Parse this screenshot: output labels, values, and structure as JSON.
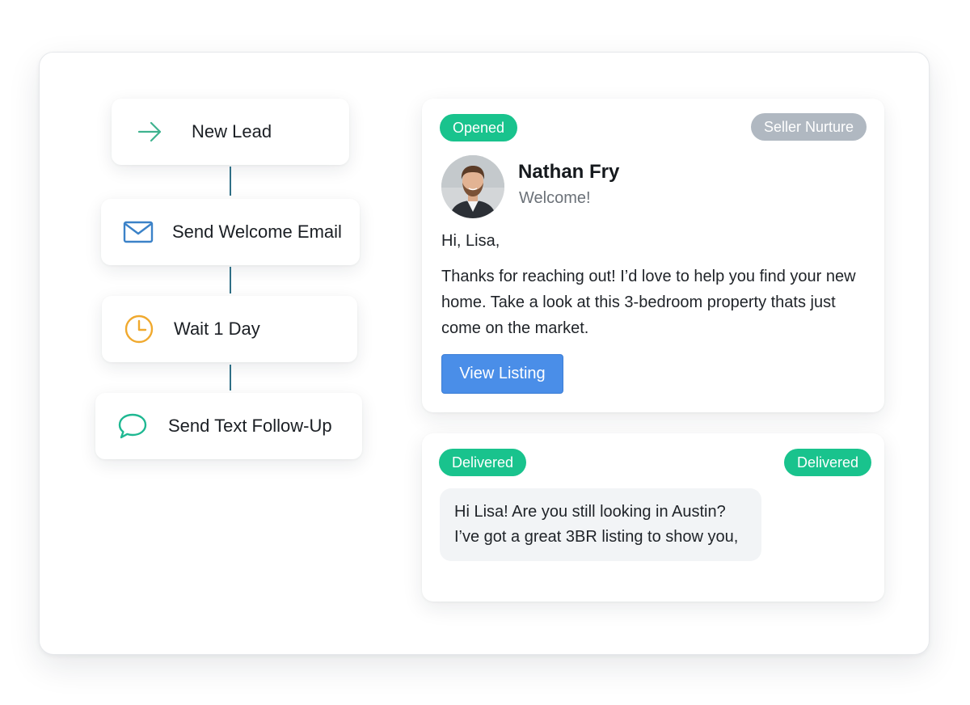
{
  "workflow": {
    "steps": [
      {
        "label": "New Lead",
        "icon": "arrow-right-icon",
        "icon_color": "#3fb38f"
      },
      {
        "label": "Send Welcome Email",
        "icon": "envelope-icon",
        "icon_color": "#3b82c8"
      },
      {
        "label": "Wait 1 Day",
        "icon": "clock-icon",
        "icon_color": "#f0a92e"
      },
      {
        "label": "Send Text Follow-Up",
        "icon": "chat-bubble-icon",
        "icon_color": "#1fb892"
      }
    ],
    "connector_color": "#2f6f86"
  },
  "email_card": {
    "status_badge": "Opened",
    "campaign_badge": "Seller Nurture",
    "sender_name": "Nathan Fry",
    "subject": "Welcome!",
    "greeting": "Hi, Lisa,",
    "body": "Thanks for reaching out! I’d love to help you find your new home. Take a look at this 3-bedroom property thats just come on the market.",
    "button_label": "View Listing"
  },
  "sms_card": {
    "status_left": "Delivered",
    "status_right": "Delivered",
    "message_line_1": "Hi Lisa! Are you still looking in Austin?",
    "message_line_2": "I’ve got a great 3BR listing to show you,"
  },
  "colors": {
    "success_green": "#19c38d",
    "neutral_badge": "#b0b8c1",
    "primary_button": "#4a8ee8"
  }
}
